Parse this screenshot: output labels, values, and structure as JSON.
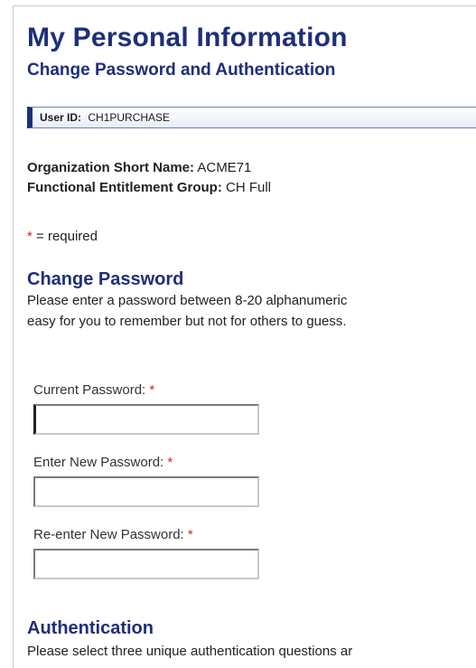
{
  "page": {
    "title": "My Personal Information",
    "subtitle": "Change Password and Authentication"
  },
  "user_bar": {
    "label": "User ID:",
    "value": "CH1PURCHASE"
  },
  "org_info": {
    "org_label": "Organization Short Name:",
    "org_value": "ACME71",
    "group_label": "Functional Entitlement Group:",
    "group_value": "CH Full"
  },
  "required_note": {
    "marker": "*",
    "text": "= required"
  },
  "change_password": {
    "heading": "Change Password",
    "description_line1": "Please enter a password between 8-20 alphanumeric",
    "description_line2": "easy for you to remember but not for others to guess.",
    "fields": [
      {
        "label": "Current Password:",
        "required": "*",
        "value": "",
        "placeholder": ""
      },
      {
        "label": "Enter New Password:",
        "required": "*",
        "value": "",
        "placeholder": ""
      },
      {
        "label": "Re-enter New Password:",
        "required": "*",
        "value": "",
        "placeholder": ""
      }
    ]
  },
  "authentication": {
    "heading": "Authentication",
    "description_line1": "Please select three unique authentication questions ar"
  },
  "colors": {
    "heading_blue": "#1e2f7a",
    "required_red": "#d42020"
  }
}
